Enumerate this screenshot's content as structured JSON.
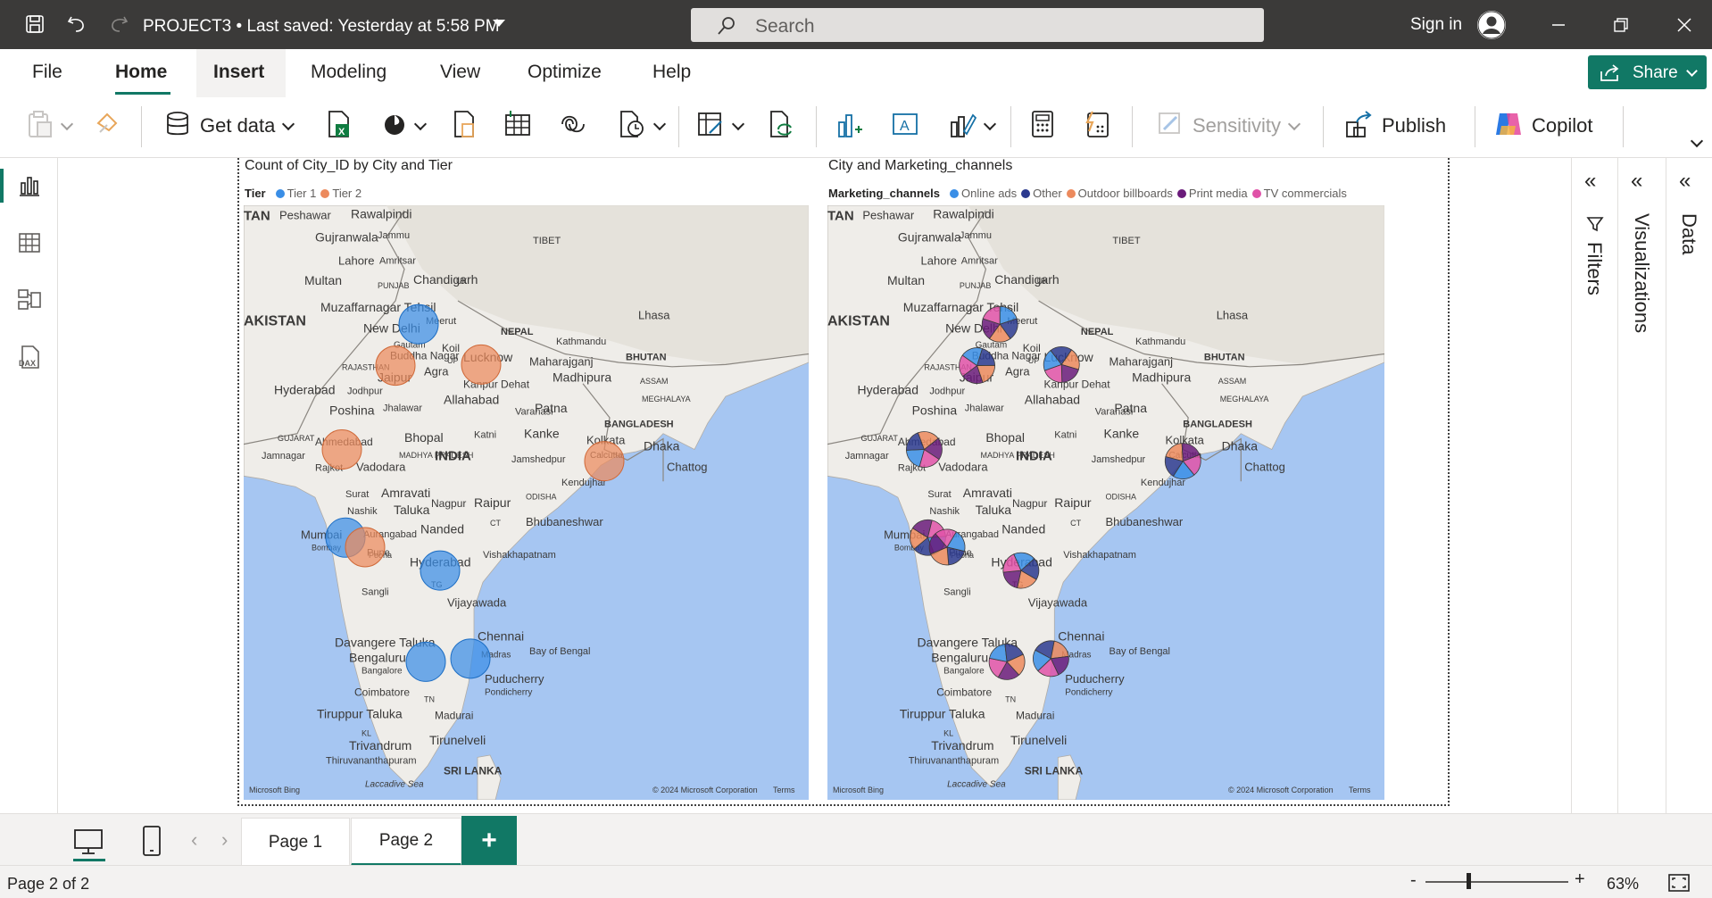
{
  "titlebar": {
    "doc_title": "PROJECT3 • Last saved: Yesterday at 5:58 PM",
    "search_placeholder": "Search",
    "sign_in": "Sign in"
  },
  "menu": {
    "tabs": [
      "File",
      "Home",
      "Insert",
      "Modeling",
      "View",
      "Optimize",
      "Help"
    ],
    "active": "Home",
    "share_label": "Share"
  },
  "ribbon": {
    "get_data": "Get data",
    "sensitivity": "Sensitivity",
    "publish": "Publish",
    "copilot": "Copilot"
  },
  "left_nav": [
    "report-view",
    "table-view",
    "model-view",
    "dax-query-view"
  ],
  "charts": {
    "left": {
      "title": "Count of City_ID by City and Tier",
      "legend_title": "Tier",
      "legend": [
        {
          "name": "Tier 1",
          "color": "#3a8ee6"
        },
        {
          "name": "Tier 2",
          "color": "#ec8a5d"
        }
      ]
    },
    "right": {
      "title": "City and Marketing_channels",
      "legend_title": "Marketing_channels",
      "legend": [
        {
          "name": "Online ads",
          "color": "#3a8ee6"
        },
        {
          "name": "Other",
          "color": "#2b3a8f"
        },
        {
          "name": "Outdoor billboards",
          "color": "#ec8a5d"
        },
        {
          "name": "Print media",
          "color": "#6a1b7a"
        },
        {
          "name": "TV commercials",
          "color": "#e052a8"
        }
      ]
    }
  },
  "map_labels": {
    "peshawar": "Peshawar",
    "rawalpindi": "Rawalpindi",
    "gujranwala": "Gujranwala",
    "jammu": "Jammu",
    "tibet": "TIBET",
    "lahore": "Lahore",
    "amritsar": "Amritsar",
    "multan": "Multan",
    "chandigarh": "Chandigarh",
    "punjab": "PUNJAB",
    "uk": "UK",
    "muzaffarnagar": "Muzaffarnagar Tehsil",
    "lhasa": "Lhasa",
    "pakistan": "AKISTAN",
    "tan": "TAN",
    "newdelhi": "New Delhi",
    "meerut": "Meerut",
    "nepal": "NEPAL",
    "kathmandu": "Kathmandu",
    "buddha": "Buddha Nagar",
    "gautam": "Gautam",
    "koil": "Koil",
    "up": "UP",
    "lucknow": "Lucknow",
    "maharajganj": "Maharajganj",
    "bhutan": "BHUTAN",
    "rajasthan": "RAJASTHAN",
    "jaipur": "Jaipur",
    "agra": "Agra",
    "kanpur": "Kanpur Dehat",
    "madhipura": "Madhipura",
    "assam": "ASSAM",
    "hyderabad_pk": "Hyderabad",
    "jodhpur": "Jodhpur",
    "allahabad": "Allahabad",
    "varanasi": "Varanasi",
    "patna": "Patna",
    "meghalaya": "MEGHALAYA",
    "poshina": "Poshina",
    "jhalawar": "Jhalawar",
    "bangladesh": "BANGLADESH",
    "gujarat": "GUJARAT",
    "ahmedabad": "Ahmedabad",
    "bhopal": "Bhopal",
    "katni": "Katni",
    "kanke": "Kanke",
    "kolkata": "Kolkata",
    "dhaka": "Dhaka",
    "jamnagar": "Jamnagar",
    "rajkot": "Rajkot",
    "vadodara": "Vadodara",
    "madhya": "MADHYA PRADESH",
    "india": "INDIA",
    "jamshedpur": "Jamshedpur",
    "calcutta": "Calcutta",
    "chattogram": "Chattog",
    "kendujhar": "Kendujhar",
    "surat": "Surat",
    "amravati": "Amravati",
    "odisha": "ODISHA",
    "nashik": "Nashik",
    "taluka": "Taluka",
    "nagpur": "Nagpur",
    "raipur": "Raipur",
    "mumbai": "Mumbai",
    "bombay": "Bombay",
    "aurangabad": "Aurangabad",
    "nanded": "Nanded",
    "bhubaneshwar": "Bhubaneshwar",
    "pune": "Pune",
    "poona": "Poona",
    "vishakhapatnam": "Vishakhapatnam",
    "hyderabad": "Hyderabad",
    "tg": "TG",
    "ct": "CT",
    "sangli": "Sangli",
    "vijayawada": "Vijayawada",
    "davangere": "Davangere Taluka",
    "chennai": "Chennai",
    "bengaluru": "Bengaluru",
    "bangalore": "Bangalore",
    "madras": "Madras",
    "bayofbengal": "Bay of Bengal",
    "puducherry": "Puducherry",
    "pondicherry": "Pondicherry",
    "coimbatore": "Coimbatore",
    "tn": "TN",
    "tiruppur": "Tiruppur Taluka",
    "madurai": "Madurai",
    "kl": "KL",
    "trivandrum": "Trivandrum",
    "thiruvananthapuram": "Thiruvananthapuram",
    "tirunelveli": "Tirunelveli",
    "srilanka": "SRI LANKA",
    "laccadive": "Laccadive Sea",
    "bing": "Microsoft Bing",
    "copyright": "© 2024 Microsoft Corporation",
    "terms": "Terms"
  },
  "pages": {
    "tabs": [
      "Page 1",
      "Page 2"
    ],
    "active": "Page 2",
    "add": "+"
  },
  "status": {
    "page": "Page 2 of 2",
    "zoom": "63%"
  }
}
